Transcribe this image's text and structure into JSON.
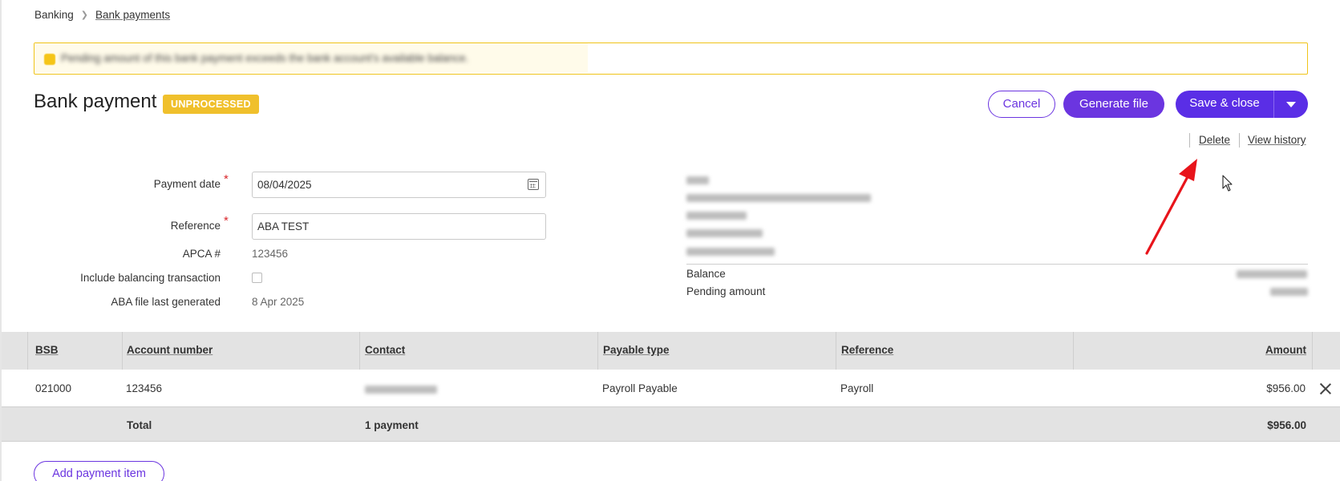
{
  "breadcrumb": {
    "root": "Banking",
    "current": "Bank payments"
  },
  "banner": {
    "message": "Pending amount of this bank payment exceeds the bank account's available balance."
  },
  "header": {
    "title": "Bank payment",
    "status": "UNPROCESSED",
    "cancel_label": "Cancel",
    "generate_label": "Generate file",
    "save_label": "Save & close"
  },
  "actions": {
    "delete_label": "Delete",
    "history_label": "View history"
  },
  "form": {
    "payment_date_label": "Payment date",
    "payment_date_value": "08/04/2025",
    "reference_label": "Reference",
    "reference_value": "ABA TEST",
    "apca_label": "APCA #",
    "apca_value": "123456",
    "balancing_label": "Include balancing transaction",
    "balancing_checked": false,
    "aba_label": "ABA file last generated",
    "aba_value": "8 Apr 2025",
    "required_mark": "*"
  },
  "account_info": {
    "balance_label": "Balance",
    "pending_label": "Pending amount"
  },
  "table": {
    "columns": [
      "BSB",
      "Account number",
      "Contact",
      "Payable type",
      "Reference",
      "Amount"
    ],
    "rows": [
      {
        "bsb": "021000",
        "account": "123456",
        "payable_type": "Payroll Payable",
        "reference": "Payroll",
        "amount": "$956.00"
      }
    ],
    "total_label": "Total",
    "total_count": "1 payment",
    "total_amount": "$956.00"
  },
  "footer": {
    "add_label": "Add payment item"
  },
  "colors": {
    "accent": "#6b35e0",
    "status": "#f0c02c",
    "warning_border": "#f0c419",
    "annotation": "#e8141b"
  }
}
